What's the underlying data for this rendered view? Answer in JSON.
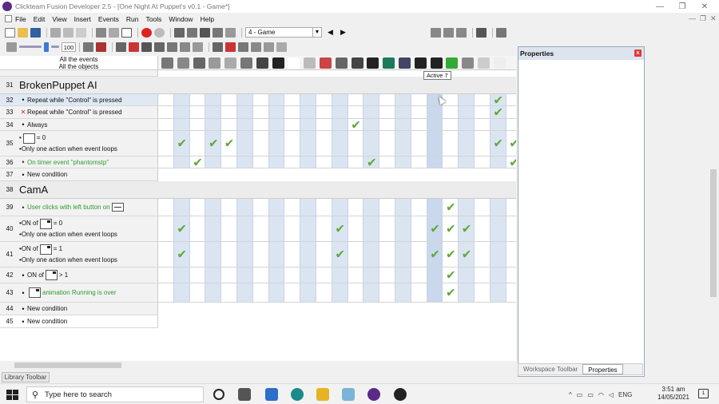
{
  "window": {
    "title": "Clickteam Fusion Developer 2.5 - [One Night At Puppet's v0.1 - Game*]",
    "minimize": "—",
    "restore": "❐",
    "close": "✕",
    "inner_min": "—",
    "inner_restore": "❐",
    "inner_close": "✕"
  },
  "menu": [
    "File",
    "Edit",
    "View",
    "Insert",
    "Events",
    "Run",
    "Tools",
    "Window",
    "Help"
  ],
  "toolbar": {
    "frame_select": "4 - Game",
    "zoom_value": "100"
  },
  "editor": {
    "header_line1": "All the events",
    "header_line2": "All the objects",
    "tooltip": "Active 7",
    "groups": [
      {
        "num": "31",
        "name": "BrokenPuppet AI"
      },
      {
        "num": "38",
        "name": "CamA"
      }
    ],
    "rows": [
      {
        "num": "32",
        "bullet": "•",
        "text": "Repeat while \"Control\" is pressed"
      },
      {
        "num": "33",
        "bullet": "✕",
        "text": "Repeat while \"Control\" is pressed"
      },
      {
        "num": "34",
        "bullet": "•",
        "text": "Always"
      },
      {
        "num": "35",
        "line1": "= 0",
        "line2": "Only one action when event loops"
      },
      {
        "num": "36",
        "bullet": "•",
        "text": "On timer event \"phantomstp\""
      },
      {
        "num": "37",
        "bullet": "•",
        "text": "New condition"
      },
      {
        "num": "39",
        "bullet": "•",
        "text": "User clicks with left button on"
      },
      {
        "num": "40",
        "pre": "ON of",
        "post": "= 0",
        "line2": "Only one action when event loops"
      },
      {
        "num": "41",
        "pre": "ON of",
        "post": "= 1",
        "line2": "Only one action when event loops"
      },
      {
        "num": "42",
        "pre": "ON of",
        "post": "> 1"
      },
      {
        "num": "43",
        "text": "animation Running is over"
      },
      {
        "num": "44",
        "bullet": "•",
        "text": "New condition"
      },
      {
        "num": "45",
        "bullet": "•",
        "text": "New condition"
      }
    ]
  },
  "properties": {
    "title": "Properties",
    "close": "x",
    "tabs": [
      "Workspace Toolbar",
      "Properties"
    ]
  },
  "library_tab": "Library Toolbar",
  "taskbar": {
    "search_placeholder": "Type here to search",
    "lang": "ENG",
    "time": "3:51 am",
    "date": "14/05/2021",
    "notif": "1"
  },
  "colors": {
    "check": "#5fa83a",
    "green_text": "#2e9b2e",
    "grid_col": "#dbe5f1",
    "grid_col_alt": "#ffffff"
  }
}
